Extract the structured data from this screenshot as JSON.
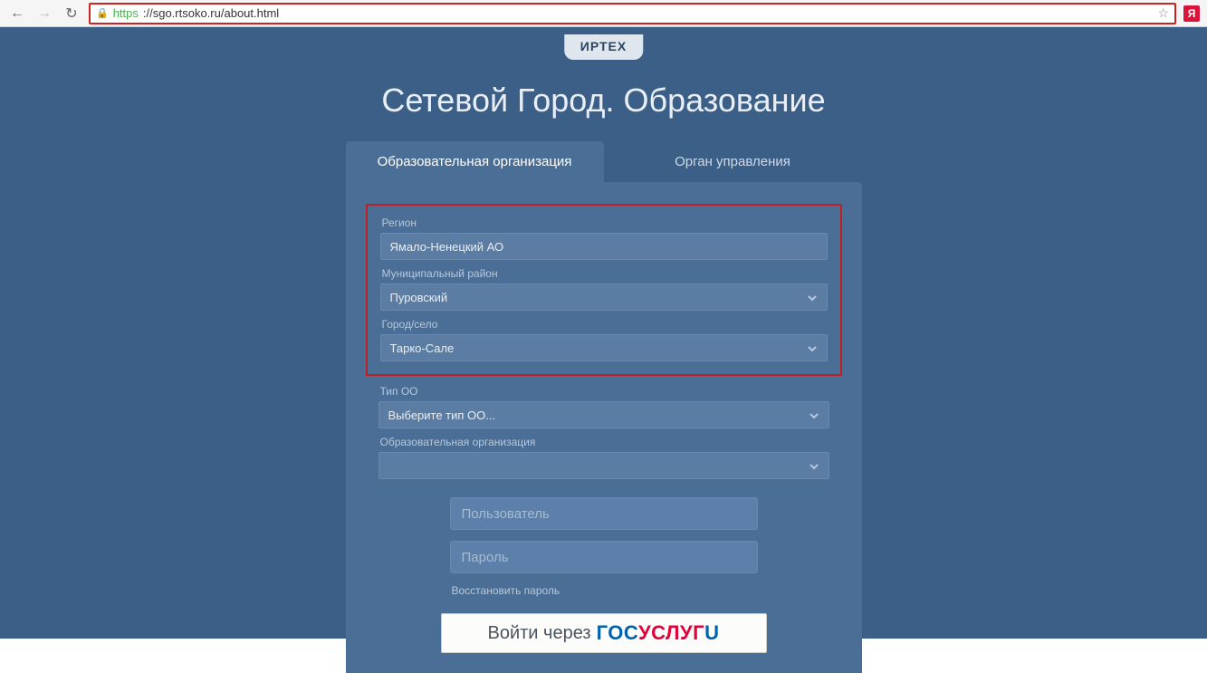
{
  "browser": {
    "url_https": "https",
    "url_rest": "://sgo.rtsoko.ru/about.html",
    "yandex_label": "Я"
  },
  "logo": "ИРТЕХ",
  "title": "Сетевой Город. Образование",
  "tabs": {
    "org": "Образовательная организация",
    "authority": "Орган управления"
  },
  "fields": {
    "region": {
      "label": "Регион",
      "value": "Ямало-Ненецкий АО"
    },
    "district": {
      "label": "Муниципальный район",
      "value": "Пуровский"
    },
    "city": {
      "label": "Город/село",
      "value": "Тарко-Сале"
    },
    "type": {
      "label": "Тип ОО",
      "value": "Выберите тип ОО..."
    },
    "org": {
      "label": "Образовательная организация",
      "value": ""
    }
  },
  "credentials": {
    "user_placeholder": "Пользователь",
    "pass_placeholder": "Пароль",
    "forgot": "Восстановить пароль"
  },
  "gos": {
    "prefix": "Войти через",
    "b1": "ГОС",
    "r": "УСЛУГ",
    "b2": "U"
  }
}
